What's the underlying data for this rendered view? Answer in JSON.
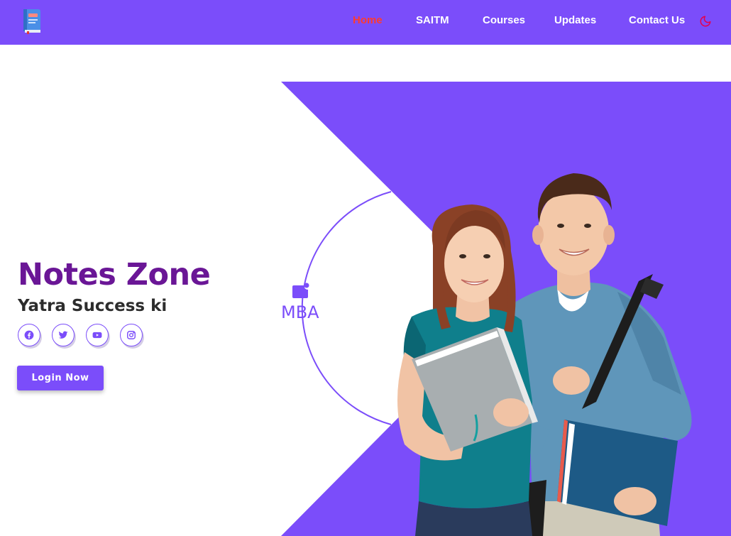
{
  "navbar": {
    "logo_icon": "book-icon",
    "items": [
      {
        "label": "Home",
        "active": true
      },
      {
        "label": "SAITM",
        "active": false
      },
      {
        "label": "Courses",
        "active": false
      },
      {
        "label": "Updates",
        "active": false
      },
      {
        "label": "Contact Us",
        "active": false
      }
    ],
    "theme_toggle_icon": "moon-icon"
  },
  "hero": {
    "title": "Notes Zone",
    "tagline": "Yatra Success ki",
    "social_icons": [
      "facebook-icon",
      "twitter-icon",
      "youtube-icon",
      "instagram-icon"
    ],
    "login_label": "Login Now",
    "course_icon": "notification-square-icon",
    "course_label": "MBA",
    "illustration": "students-holding-books"
  },
  "colors": {
    "brand": "#7b4dfa",
    "active_nav": "#ff3b2f",
    "title": "#6a1696",
    "tagline": "#2c2c2c",
    "moon": "#e6004c"
  }
}
